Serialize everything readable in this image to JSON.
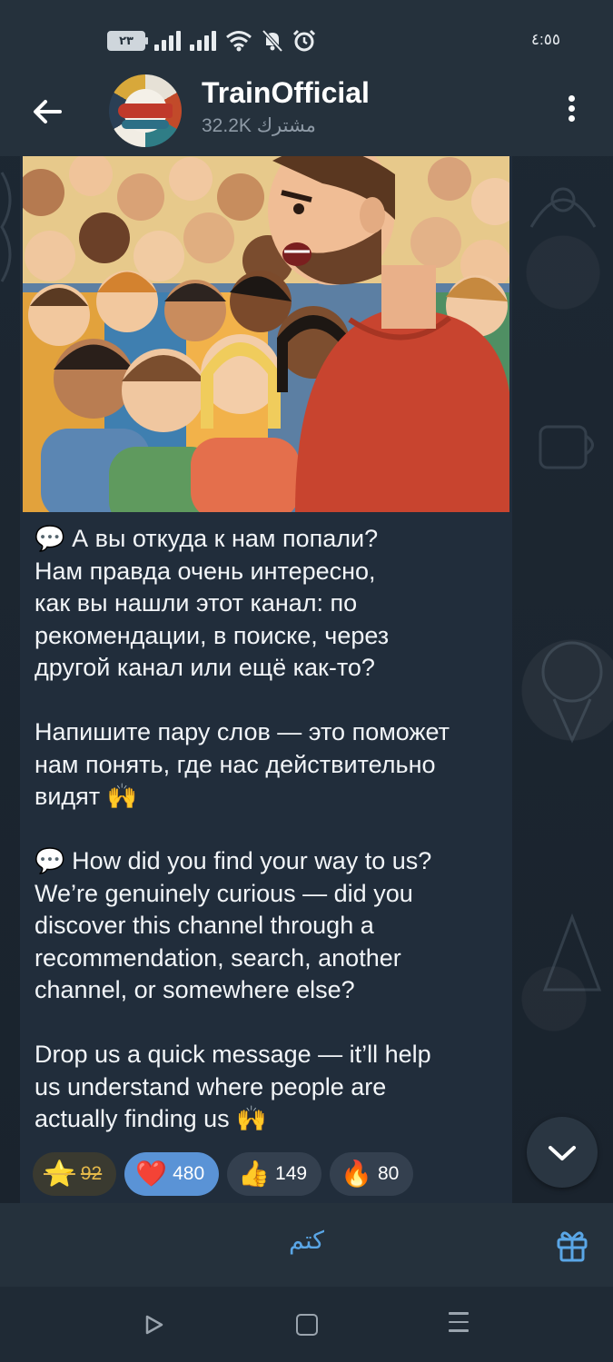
{
  "status_bar": {
    "battery_label": "٢٣",
    "time": "٤:٥٥",
    "icons": [
      "battery-icon",
      "signal-icon",
      "signal-icon",
      "wifi-icon",
      "mute-bell-icon",
      "alarm-icon"
    ]
  },
  "header": {
    "title": "TrainOfficial",
    "subscribers": "32.2K مشترك"
  },
  "message": {
    "text": "💬 А вы откуда к нам попали?\nНам правда очень интересно,\nкак вы нашли этот канал: по\nрекомендации, в поиске, через\nдругой канал или ещё как-то?\n\nНапишите пару слов — это поможет\nнам понять, где нас действительно\nвидят 🙌\n\n💬 How did you find your way to us?\nWe’re genuinely curious — did you\ndiscover this channel through a\nrecommendation, search, another\nchannel, or somewhere else?\n\nDrop us a quick message — it’ll help\nus understand where people are\nactually finding us 🙌",
    "reactions": [
      {
        "emoji": "⭐",
        "count": "92"
      },
      {
        "emoji": "❤️",
        "count": "480"
      },
      {
        "emoji": "👍",
        "count": "149"
      },
      {
        "emoji": "🔥",
        "count": "80"
      }
    ]
  },
  "bottom_bar": {
    "mute_label": "كتم"
  },
  "colors": {
    "accent": "#5aa6e6",
    "bubble": "#212d3b",
    "header": "#25313c",
    "my_reaction": "#5a93d6"
  }
}
